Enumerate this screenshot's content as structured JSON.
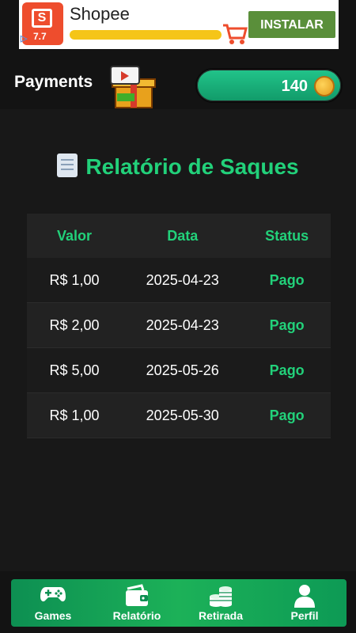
{
  "ad": {
    "title": "Shopee",
    "badge": "7.7",
    "bag_letter": "S",
    "info_glyph": "▷",
    "button_label": "INSTALAR",
    "colors": {
      "brand": "#ee4d2d",
      "button": "#5a8f3a",
      "bar": "#f5c518"
    }
  },
  "header": {
    "title": "Payments",
    "balance": "140",
    "icons": {
      "gift": "gift-box-icon",
      "coin": "coin-icon"
    }
  },
  "report": {
    "title": "Relatório de Saques",
    "icon": "document-icon",
    "columns": [
      "Valor",
      "Data",
      "Status"
    ],
    "rows": [
      {
        "valor": "R$ 1,00",
        "data": "2025-04-23",
        "status": "Pago"
      },
      {
        "valor": "R$ 2,00",
        "data": "2025-04-23",
        "status": "Pago"
      },
      {
        "valor": "R$ 5,00",
        "data": "2025-05-26",
        "status": "Pago"
      },
      {
        "valor": "R$ 1,00",
        "data": "2025-05-30",
        "status": "Pago"
      }
    ],
    "accent": "#22d17a"
  },
  "nav": {
    "items": [
      {
        "label": "Games",
        "icon": "gamepad-icon"
      },
      {
        "label": "Relatório",
        "icon": "wallet-icon"
      },
      {
        "label": "Retirada",
        "icon": "coins-stack-icon"
      },
      {
        "label": "Perfil",
        "icon": "user-icon"
      }
    ]
  }
}
